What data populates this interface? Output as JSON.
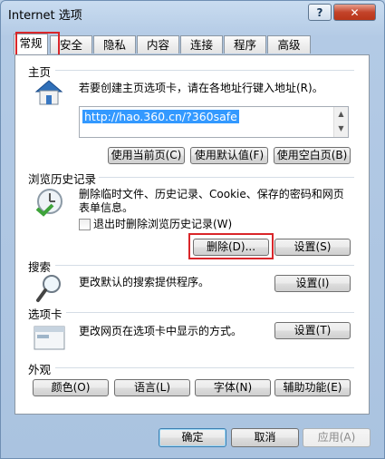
{
  "window": {
    "title": "Internet 选项",
    "help_label": "?",
    "close_label": "✕"
  },
  "tabs": [
    {
      "label": "常规"
    },
    {
      "label": "安全"
    },
    {
      "label": "隐私"
    },
    {
      "label": "内容"
    },
    {
      "label": "连接"
    },
    {
      "label": "程序"
    },
    {
      "label": "高级"
    }
  ],
  "home": {
    "group": "主页",
    "description": "若要创建主页选项卡，请在各地址行键入地址(R)。",
    "url": "http://hao.360.cn/?360safe",
    "buttons": [
      "使用当前页(C)",
      "使用默认值(F)",
      "使用空白页(B)"
    ]
  },
  "history": {
    "group": "浏览历史记录",
    "description": "删除临时文件、历史记录、Cookie、保存的密码和网页表单信息。",
    "checkbox_label": "退出时删除浏览历史记录(W)",
    "checkbox_checked": false,
    "delete_button": "删除(D)...",
    "settings_button": "设置(S)"
  },
  "search": {
    "group": "搜索",
    "description": "更改默认的搜索提供程序。",
    "settings_button": "设置(I)"
  },
  "tabs_group": {
    "group": "选项卡",
    "description": "更改网页在选项卡中显示的方式。",
    "settings_button": "设置(T)"
  },
  "appearance": {
    "group": "外观",
    "buttons": [
      "颜色(O)",
      "语言(L)",
      "字体(N)",
      "辅助功能(E)"
    ]
  },
  "footer": {
    "ok": "确定",
    "cancel": "取消",
    "apply": "应用(A)"
  },
  "colors": {
    "highlight": "#d9262a",
    "selection": "#3399ff"
  }
}
